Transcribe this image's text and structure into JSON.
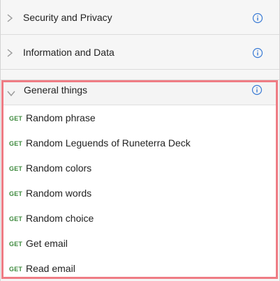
{
  "sections": [
    {
      "title": "Security and Privacy",
      "icon": "info-icon"
    },
    {
      "title": "Information and Data",
      "icon": "info-icon"
    }
  ],
  "general": {
    "title": "General things",
    "expanded": true,
    "items": [
      {
        "method": "GET",
        "label": "Random phrase"
      },
      {
        "method": "GET",
        "label": "Random Leguends of Runeterra Deck"
      },
      {
        "method": "GET",
        "label": "Random colors"
      },
      {
        "method": "GET",
        "label": "Random words"
      },
      {
        "method": "GET",
        "label": "Random choice"
      },
      {
        "method": "GET",
        "label": "Get email"
      },
      {
        "method": "GET",
        "label": "Read email"
      }
    ]
  },
  "colors": {
    "highlight_border": "#ef7c84",
    "method_get": "#3d8a3d",
    "info_icon": "#3a7bd5"
  }
}
